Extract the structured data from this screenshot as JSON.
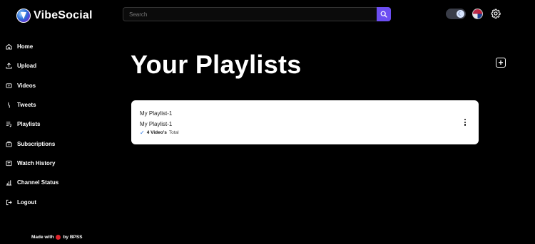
{
  "app": {
    "name": "VibeSocial"
  },
  "search": {
    "placeholder": "Search"
  },
  "sidebar": {
    "items": [
      {
        "label": "Home",
        "icon": "home-icon"
      },
      {
        "label": "Upload",
        "icon": "upload-icon"
      },
      {
        "label": "Videos",
        "icon": "video-icon"
      },
      {
        "label": "Tweets",
        "icon": "tweet-icon"
      },
      {
        "label": "Playlists",
        "icon": "playlist-icon"
      },
      {
        "label": "Subscriptions",
        "icon": "subscriptions-icon"
      },
      {
        "label": "Watch History",
        "icon": "history-icon"
      },
      {
        "label": "Channel Status",
        "icon": "status-icon"
      },
      {
        "label": "Logout",
        "icon": "logout-icon"
      }
    ]
  },
  "footer": {
    "made_with": "Made with",
    "by": "by BPSS"
  },
  "main": {
    "title": "Your Playlists",
    "playlists": [
      {
        "name": "My Playlist-1",
        "description": "My Playlist-1",
        "video_count": "4 Video's",
        "total_label": "Total"
      }
    ]
  },
  "colors": {
    "accent": "#6c4ef2",
    "background": "#000000",
    "card": "#ffffff",
    "check": "#1e6fe0"
  }
}
